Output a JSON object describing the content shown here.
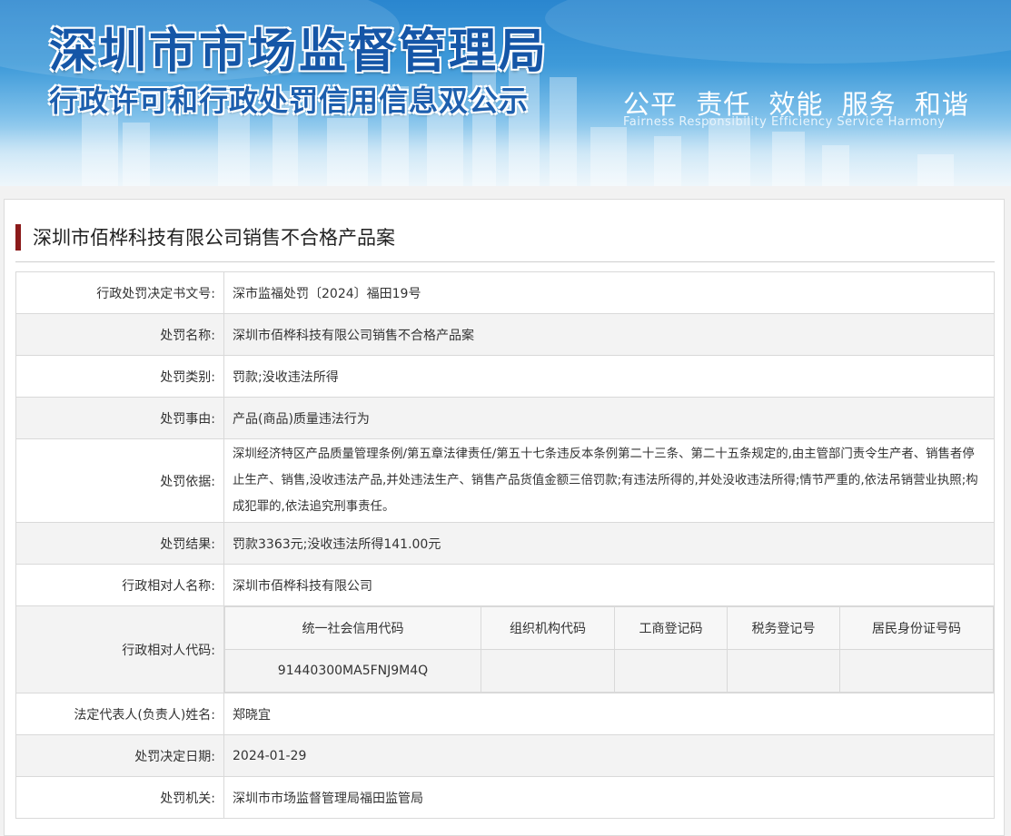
{
  "banner": {
    "title": "深圳市市场监督管理局",
    "subtitle": "行政许可和行政处罚信用信息双公示",
    "slogan_cn": "公平 责任 效能 服务 和谐",
    "slogan_en": "Fairness Responsibility Efficiency Service Harmony"
  },
  "case": {
    "title": "深圳市佰桦科技有限公司销售不合格产品案",
    "rows": [
      {
        "label": "行政处罚决定书文号:",
        "value": "深市监福处罚〔2024〕福田19号"
      },
      {
        "label": "处罚名称:",
        "value": "深圳市佰桦科技有限公司销售不合格产品案"
      },
      {
        "label": "处罚类别:",
        "value": "罚款;没收违法所得"
      },
      {
        "label": "处罚事由:",
        "value": "产品(商品)质量违法行为"
      },
      {
        "label": "处罚依据:",
        "value": "深圳经济特区产品质量管理条例/第五章法律责任/第五十七条违反本条例第二十三条、第二十五条规定的,由主管部门责令生产者、销售者停止生产、销售,没收违法产品,并处违法生产、销售产品货值金额三倍罚款;有违法所得的,并处没收违法所得;情节严重的,依法吊销营业执照;构成犯罪的,依法追究刑事责任。"
      },
      {
        "label": "处罚结果:",
        "value": "罚款3363元;没收违法所得141.00元"
      },
      {
        "label": "行政相对人名称:",
        "value": "深圳市佰桦科技有限公司"
      }
    ],
    "codes": {
      "label": "行政相对人代码:",
      "headers": [
        "统一社会信用代码",
        "组织机构代码",
        "工商登记码",
        "税务登记号",
        "居民身份证号码"
      ],
      "values": [
        "91440300MA5FNJ9M4Q",
        "",
        "",
        "",
        ""
      ]
    },
    "rows_after": [
      {
        "label": "法定代表人(负责人)姓名:",
        "value": "郑晓宜"
      },
      {
        "label": "处罚决定日期:",
        "value": "2024-01-29"
      },
      {
        "label": "处罚机关:",
        "value": "深圳市市场监督管理局福田监管局"
      }
    ]
  }
}
